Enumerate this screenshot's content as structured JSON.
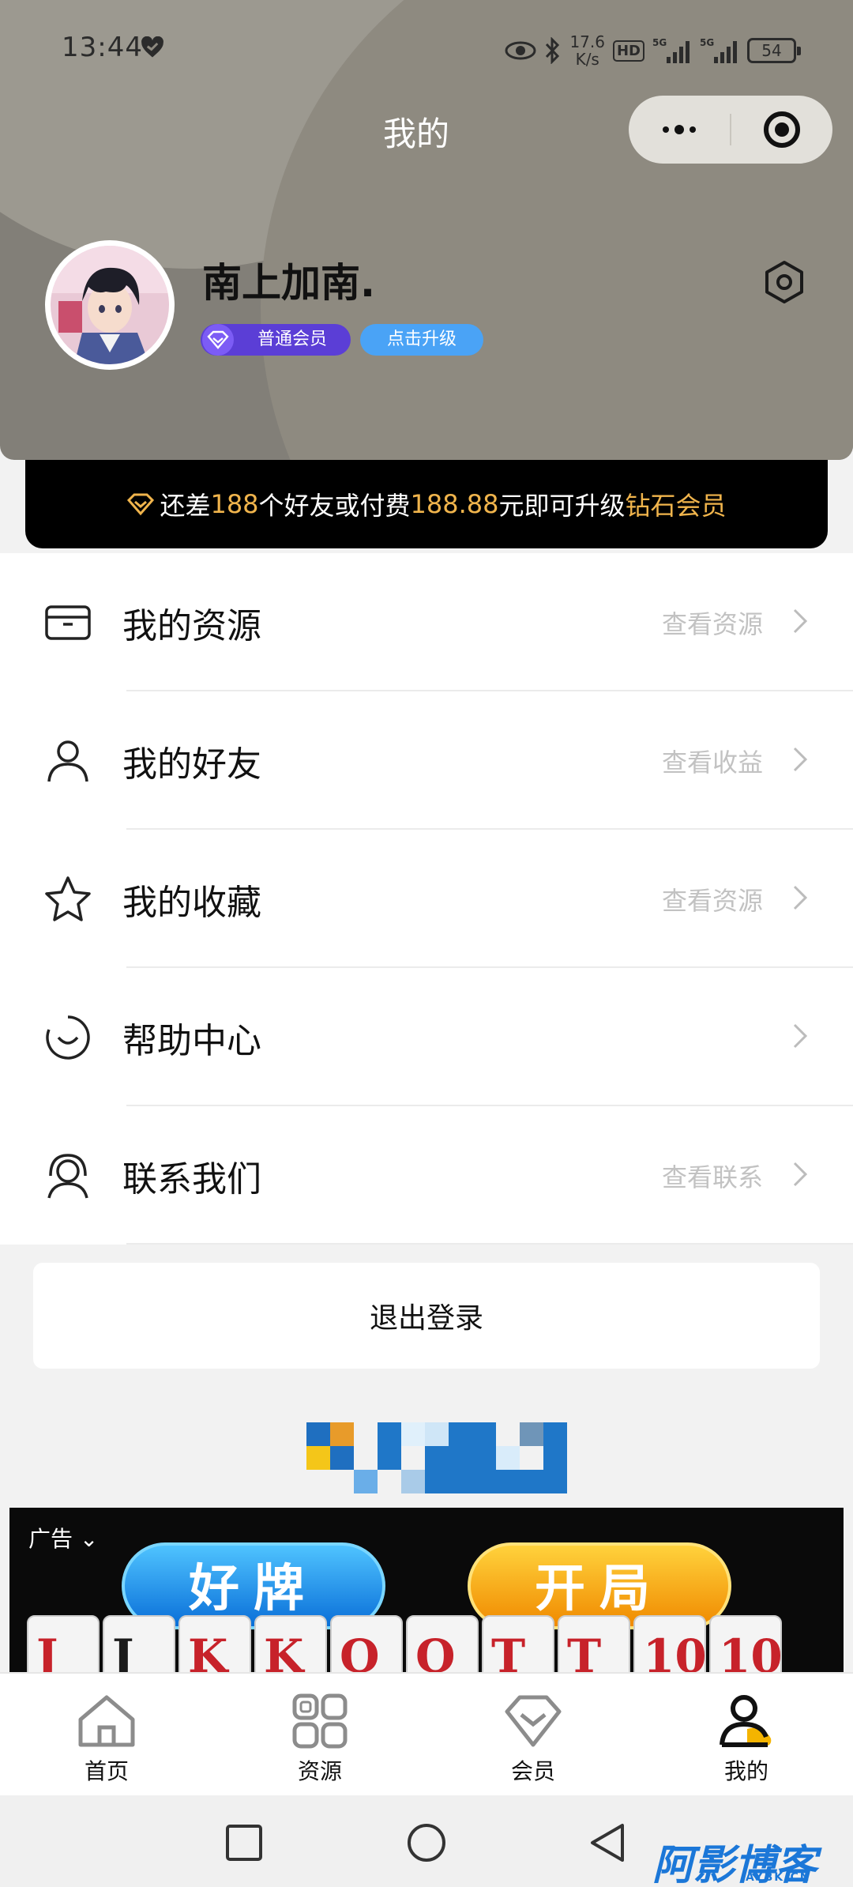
{
  "status_bar": {
    "time": "13:44",
    "net_speed_value": "17.6",
    "net_speed_unit": "K/s",
    "hd": "HD",
    "signal_1": "5G",
    "signal_2": "5G",
    "battery": "54"
  },
  "header": {
    "title": "我的",
    "username": "南上加南.",
    "member_level": "普通会员",
    "upgrade_button": "点击升级"
  },
  "banner": {
    "text_1": "还差",
    "friends_needed": "188",
    "text_2": "个好友或付费",
    "amount": "188.88",
    "text_3": "元即可升级",
    "target_level": "钻石会员"
  },
  "menu": [
    {
      "label": "我的资源",
      "link": "查看资源",
      "icon": "card-icon"
    },
    {
      "label": "我的好友",
      "link": "查看收益",
      "icon": "user-icon"
    },
    {
      "label": "我的收藏",
      "link": "查看资源",
      "icon": "star-icon"
    },
    {
      "label": "帮助中心",
      "link": "",
      "icon": "smile-icon"
    },
    {
      "label": "联系我们",
      "link": "查看联系",
      "icon": "headset-icon"
    }
  ],
  "logout_label": "退出登录",
  "ad": {
    "tag": "广告",
    "pill_left": "好牌",
    "pill_right": "开局",
    "cards": [
      "J",
      "J",
      "K",
      "K",
      "Q",
      "Q",
      "T",
      "T",
      "10",
      "10"
    ]
  },
  "tabs": [
    {
      "label": "首页",
      "icon": "home-icon",
      "active": false
    },
    {
      "label": "资源",
      "icon": "grid-icon",
      "active": false
    },
    {
      "label": "会员",
      "icon": "diamond-icon",
      "active": false
    },
    {
      "label": "我的",
      "icon": "profile-icon",
      "active": true
    }
  ],
  "watermark": {
    "main": "阿影博客",
    "sub": "AYBK.CN"
  },
  "colors": {
    "accent_gold": "#f0b44c",
    "member_purple": "#5b3ed6",
    "upgrade_blue": "#4aa3f6",
    "header_bg": "#827f78",
    "active_tab_yellow": "#f4b400"
  }
}
